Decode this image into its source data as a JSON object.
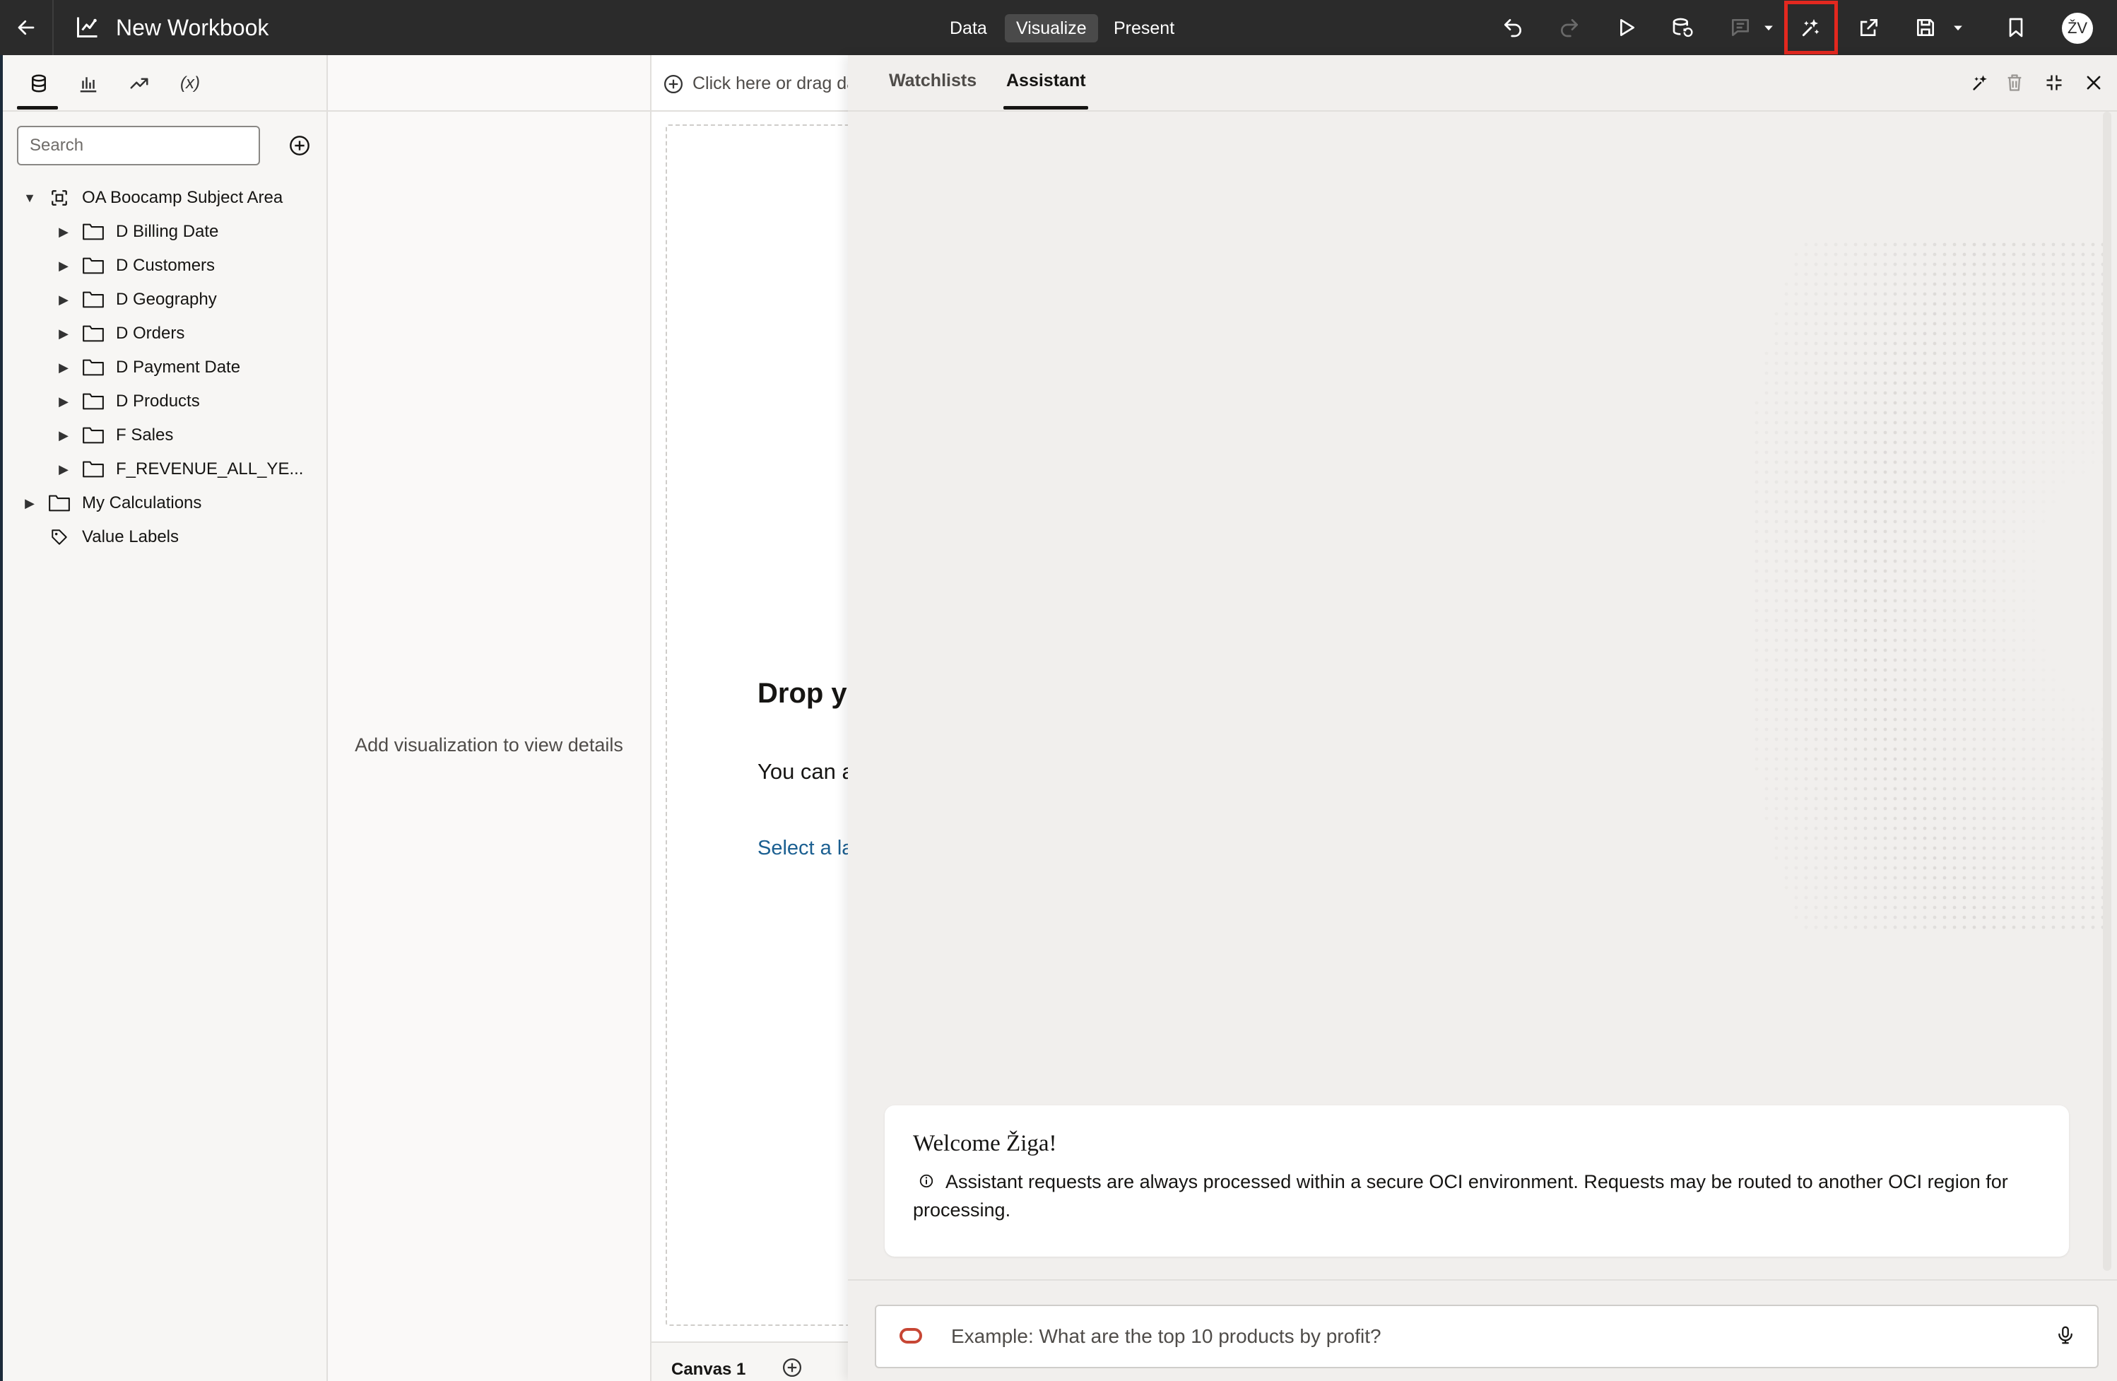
{
  "app": {
    "title": "New Workbook",
    "modes": [
      "Data",
      "Visualize",
      "Present"
    ],
    "active_mode": "Visualize",
    "user_initials": "ŽV"
  },
  "toolbar": {
    "icons": [
      "back-arrow-icon",
      "undo-icon",
      "redo-icon",
      "preview-play-icon",
      "refresh-data-icon",
      "comments-icon",
      "assistant-sparkle-icon",
      "share-export-icon",
      "save-icon",
      "bookmark-icon"
    ],
    "highlighted": "assistant-sparkle-icon",
    "highlight_color": "#e3281f"
  },
  "data_panel": {
    "tabs": [
      "data-icon",
      "visualizations-icon",
      "analytics-icon",
      "calculations-icon"
    ],
    "calc_tab_label": "(x)",
    "search_placeholder": "Search",
    "tree": [
      {
        "label": "OA Boocamp Subject Area",
        "type": "subject-area",
        "expanded": true
      },
      {
        "label": "D Billing Date",
        "type": "folder"
      },
      {
        "label": "D Customers",
        "type": "folder"
      },
      {
        "label": "D Geography",
        "type": "folder"
      },
      {
        "label": "D Orders",
        "type": "folder"
      },
      {
        "label": "D Payment Date",
        "type": "folder"
      },
      {
        "label": "D Products",
        "type": "folder"
      },
      {
        "label": "F Sales",
        "type": "folder"
      },
      {
        "label": "F_REVENUE_ALL_YE...",
        "type": "folder"
      },
      {
        "label": "My Calculations",
        "type": "folder"
      },
      {
        "label": "Value Labels",
        "type": "tag"
      }
    ]
  },
  "grammar_panel": {
    "empty_message": "Add visualization to view details"
  },
  "canvas": {
    "filter_hint": "Click here or drag da",
    "drop_title": "Drop yo visualiz",
    "drop_subtitle": "You can a drag a vis",
    "drop_link": "Select a la",
    "tab_label": "Canvas 1"
  },
  "assistant_panel": {
    "tabs": [
      "Watchlists",
      "Assistant"
    ],
    "active_tab": "Assistant",
    "welcome_title": "Welcome Žiga!",
    "welcome_text": "Assistant requests are always processed within a secure OCI environment. Requests may be routed to another OCI region for processing.",
    "prompt_placeholder": "Example: What are the top 10 products by profit?",
    "header_icons": [
      "assistant-sparkle-icon",
      "trash-icon",
      "collapse-icon",
      "close-icon"
    ]
  }
}
